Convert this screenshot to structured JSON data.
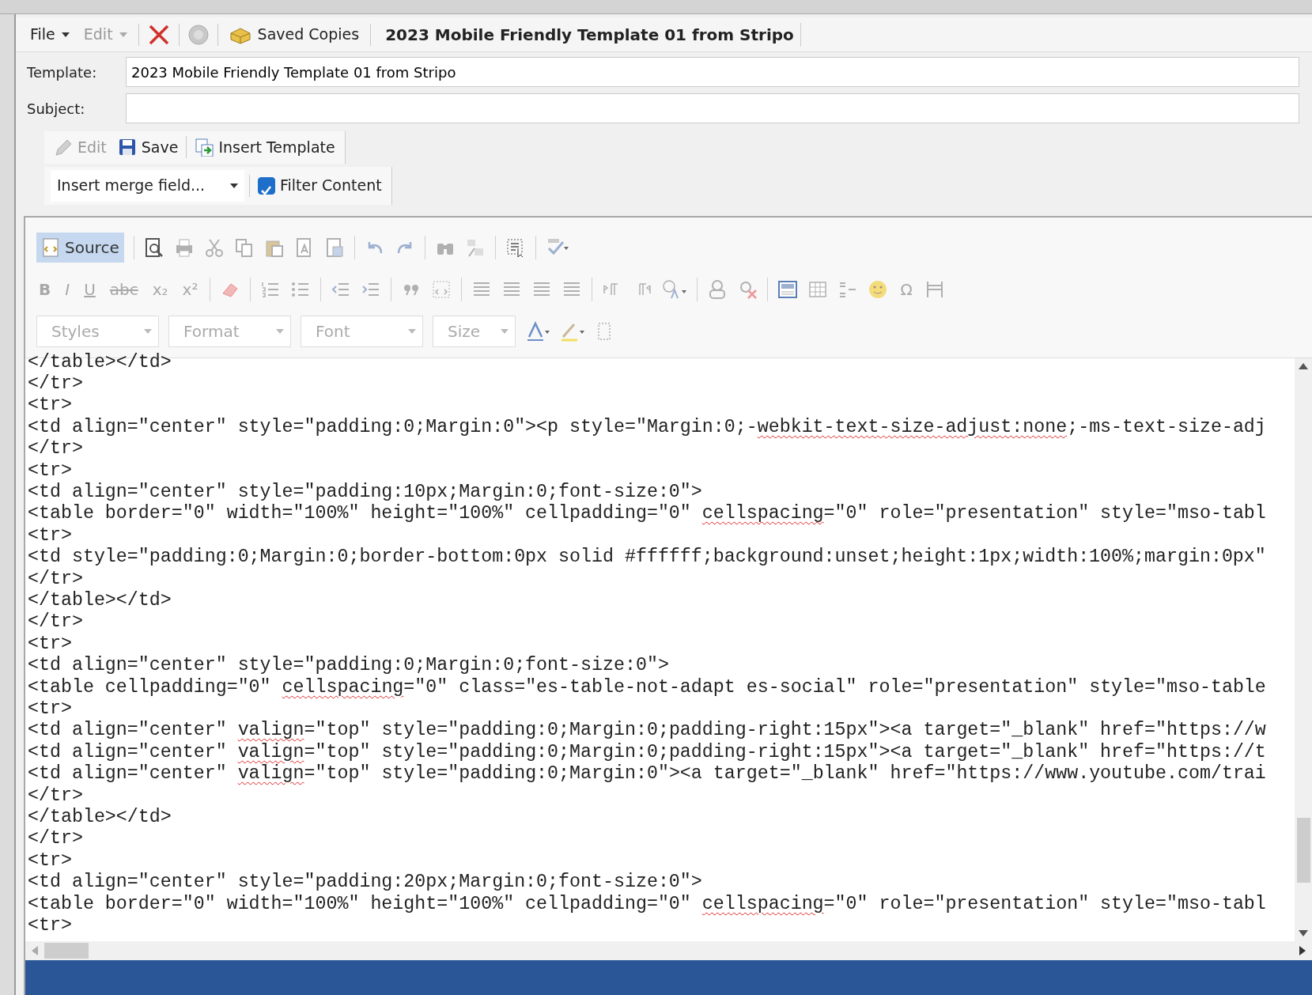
{
  "menu": [
    {
      "label": "File",
      "disabled": false
    },
    {
      "label": "Edit",
      "disabled": true
    }
  ],
  "saved_copies": "Saved Copies",
  "document_title": "2023 Mobile Friendly Template 01 from Stripo",
  "fields": [
    {
      "label": "Template:",
      "value": "2023 Mobile Friendly Template 01 from Stripo"
    },
    {
      "label": "Subject:"
    }
  ],
  "actions": [
    {
      "kind": "edit",
      "label": "Edit",
      "disabled": true
    },
    {
      "kind": "save",
      "label": "Save",
      "disabled": false
    },
    {
      "kind": "insert",
      "label": "Insert Template",
      "disabled": false
    }
  ],
  "merge_field": {
    "value": "Insert merge field..."
  },
  "filter_content": {
    "label": "Filter Content",
    "checked": true
  },
  "editor_toolbar": {
    "source": {
      "label": "Source",
      "selected": true
    },
    "format_glyphs": [
      {
        "label": "B"
      },
      {
        "label": "I"
      },
      {
        "label": "U"
      },
      {
        "label": "abc"
      },
      {
        "label": "x₂"
      },
      {
        "label": "x²"
      }
    ],
    "symbol_glyph": "Ω",
    "dropdowns": [
      {
        "label": "Styles"
      },
      {
        "label": "Format"
      },
      {
        "label": "Font"
      },
      {
        "label": "Size"
      }
    ]
  },
  "code_lines": [
    {
      "parts": [
        {
          "text": "</table></td>",
          "misspelled": false
        }
      ]
    },
    {
      "parts": [
        {
          "text": "</tr>",
          "misspelled": false
        }
      ]
    },
    {
      "parts": [
        {
          "text": "<tr>",
          "misspelled": false
        }
      ]
    },
    {
      "parts": [
        {
          "text": "<td align=\"center\" style=\"padding:0;Margin:0\"><p style=\"Margin:0;-",
          "misspelled": false
        },
        {
          "text": "webkit-text-size-adjust:none",
          "misspelled": true
        },
        {
          "text": ";-ms-text-size-adj",
          "misspelled": false
        }
      ]
    },
    {
      "parts": [
        {
          "text": "</tr>",
          "misspelled": false
        }
      ]
    },
    {
      "parts": [
        {
          "text": "<tr>",
          "misspelled": false
        }
      ]
    },
    {
      "parts": [
        {
          "text": "<td align=\"center\" style=\"padding:10px;Margin:0;font-size:0\">",
          "misspelled": false
        }
      ]
    },
    {
      "parts": [
        {
          "text": "<table border=\"0\" width=\"100%\" height=\"100%\" cellpadding=\"0\" ",
          "misspelled": false
        },
        {
          "text": "cellspacing",
          "misspelled": true
        },
        {
          "text": "=\"0\" role=\"presentation\" style=\"mso-tabl",
          "misspelled": false
        }
      ]
    },
    {
      "parts": [
        {
          "text": "<tr>",
          "misspelled": false
        }
      ]
    },
    {
      "parts": [
        {
          "text": "<td style=\"padding:0;Margin:0;border-bottom:0px solid #ffffff;background:unset;height:1px;width:100%;margin:0px\"",
          "misspelled": false
        }
      ]
    },
    {
      "parts": [
        {
          "text": "</tr>",
          "misspelled": false
        }
      ]
    },
    {
      "parts": [
        {
          "text": "</table></td>",
          "misspelled": false
        }
      ]
    },
    {
      "parts": [
        {
          "text": "</tr>",
          "misspelled": false
        }
      ]
    },
    {
      "parts": [
        {
          "text": "<tr>",
          "misspelled": false
        }
      ]
    },
    {
      "parts": [
        {
          "text": "<td align=\"center\" style=\"padding:0;Margin:0;font-size:0\">",
          "misspelled": false
        }
      ]
    },
    {
      "parts": [
        {
          "text": "<table cellpadding=\"0\" ",
          "misspelled": false
        },
        {
          "text": "cellspacing",
          "misspelled": true
        },
        {
          "text": "=\"0\" class=\"es-table-not-adapt es-social\" role=\"presentation\" style=\"mso-table",
          "misspelled": false
        }
      ]
    },
    {
      "parts": [
        {
          "text": "<tr>",
          "misspelled": false
        }
      ]
    },
    {
      "parts": [
        {
          "text": "<td align=\"center\" ",
          "misspelled": false
        },
        {
          "text": "valign",
          "misspelled": true
        },
        {
          "text": "=\"top\" style=\"padding:0;Margin:0;padding-right:15px\"><a target=\"_blank\" href=\"https://w",
          "misspelled": false
        }
      ]
    },
    {
      "parts": [
        {
          "text": "<td align=\"center\" ",
          "misspelled": false
        },
        {
          "text": "valign",
          "misspelled": true
        },
        {
          "text": "=\"top\" style=\"padding:0;Margin:0;padding-right:15px\"><a target=\"_blank\" href=\"https://t",
          "misspelled": false
        }
      ]
    },
    {
      "parts": [
        {
          "text": "<td align=\"center\" ",
          "misspelled": false
        },
        {
          "text": "valign",
          "misspelled": true
        },
        {
          "text": "=\"top\" style=\"padding:0;Margin:0\"><a target=\"_blank\" href=\"https://www.youtube.com/trai",
          "misspelled": false
        }
      ]
    },
    {
      "parts": [
        {
          "text": "</tr>",
          "misspelled": false
        }
      ]
    },
    {
      "parts": [
        {
          "text": "</table></td>",
          "misspelled": false
        }
      ]
    },
    {
      "parts": [
        {
          "text": "</tr>",
          "misspelled": false
        }
      ]
    },
    {
      "parts": [
        {
          "text": "<tr>",
          "misspelled": false
        }
      ]
    },
    {
      "parts": [
        {
          "text": "<td align=\"center\" style=\"padding:20px;Margin:0;font-size:0\">",
          "misspelled": false
        }
      ]
    },
    {
      "parts": [
        {
          "text": "<table border=\"0\" width=\"100%\" height=\"100%\" cellpadding=\"0\" ",
          "misspelled": false
        },
        {
          "text": "cellspacing",
          "misspelled": true
        },
        {
          "text": "=\"0\" role=\"presentation\" style=\"mso-tabl",
          "misspelled": false
        }
      ]
    },
    {
      "parts": [
        {
          "text": "<tr>",
          "misspelled": false
        }
      ]
    }
  ]
}
